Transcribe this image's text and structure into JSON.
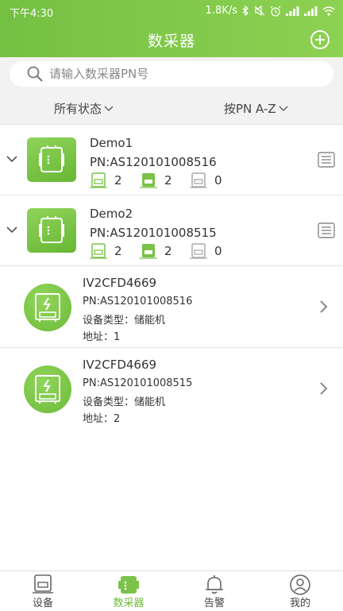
{
  "status_bar": {
    "time": "下午4:30",
    "network_speed": "1.8K/s"
  },
  "header": {
    "title": "数采器"
  },
  "search": {
    "placeholder": "请输入数采器PN号",
    "value": ""
  },
  "filters": {
    "status_label": "所有状态",
    "sort_label": "按PN A-Z"
  },
  "collectors": [
    {
      "name": "Demo1",
      "pn": "PN:AS120101008516",
      "count_a": "2",
      "count_b": "2",
      "count_c": "0"
    },
    {
      "name": "Demo2",
      "pn": "PN:AS120101008515",
      "count_a": "2",
      "count_b": "2",
      "count_c": "0"
    }
  ],
  "devices": [
    {
      "name": "IV2CFD4669",
      "pn": "PN:AS120101008516",
      "type": "设备类型：储能机",
      "address": "地址：1"
    },
    {
      "name": "IV2CFD4669",
      "pn": "PN:AS120101008515",
      "type": "设备类型：储能机",
      "address": "地址：2"
    }
  ],
  "bottom_nav": [
    {
      "label": "设备",
      "icon": "device-icon",
      "active": false
    },
    {
      "label": "数采器",
      "icon": "collector-icon",
      "active": true
    },
    {
      "label": "告警",
      "icon": "bell-icon",
      "active": false
    },
    {
      "label": "我的",
      "icon": "profile-icon",
      "active": false
    }
  ],
  "colors": {
    "brand_green": "#74c043",
    "active_green": "#6cbb38"
  }
}
